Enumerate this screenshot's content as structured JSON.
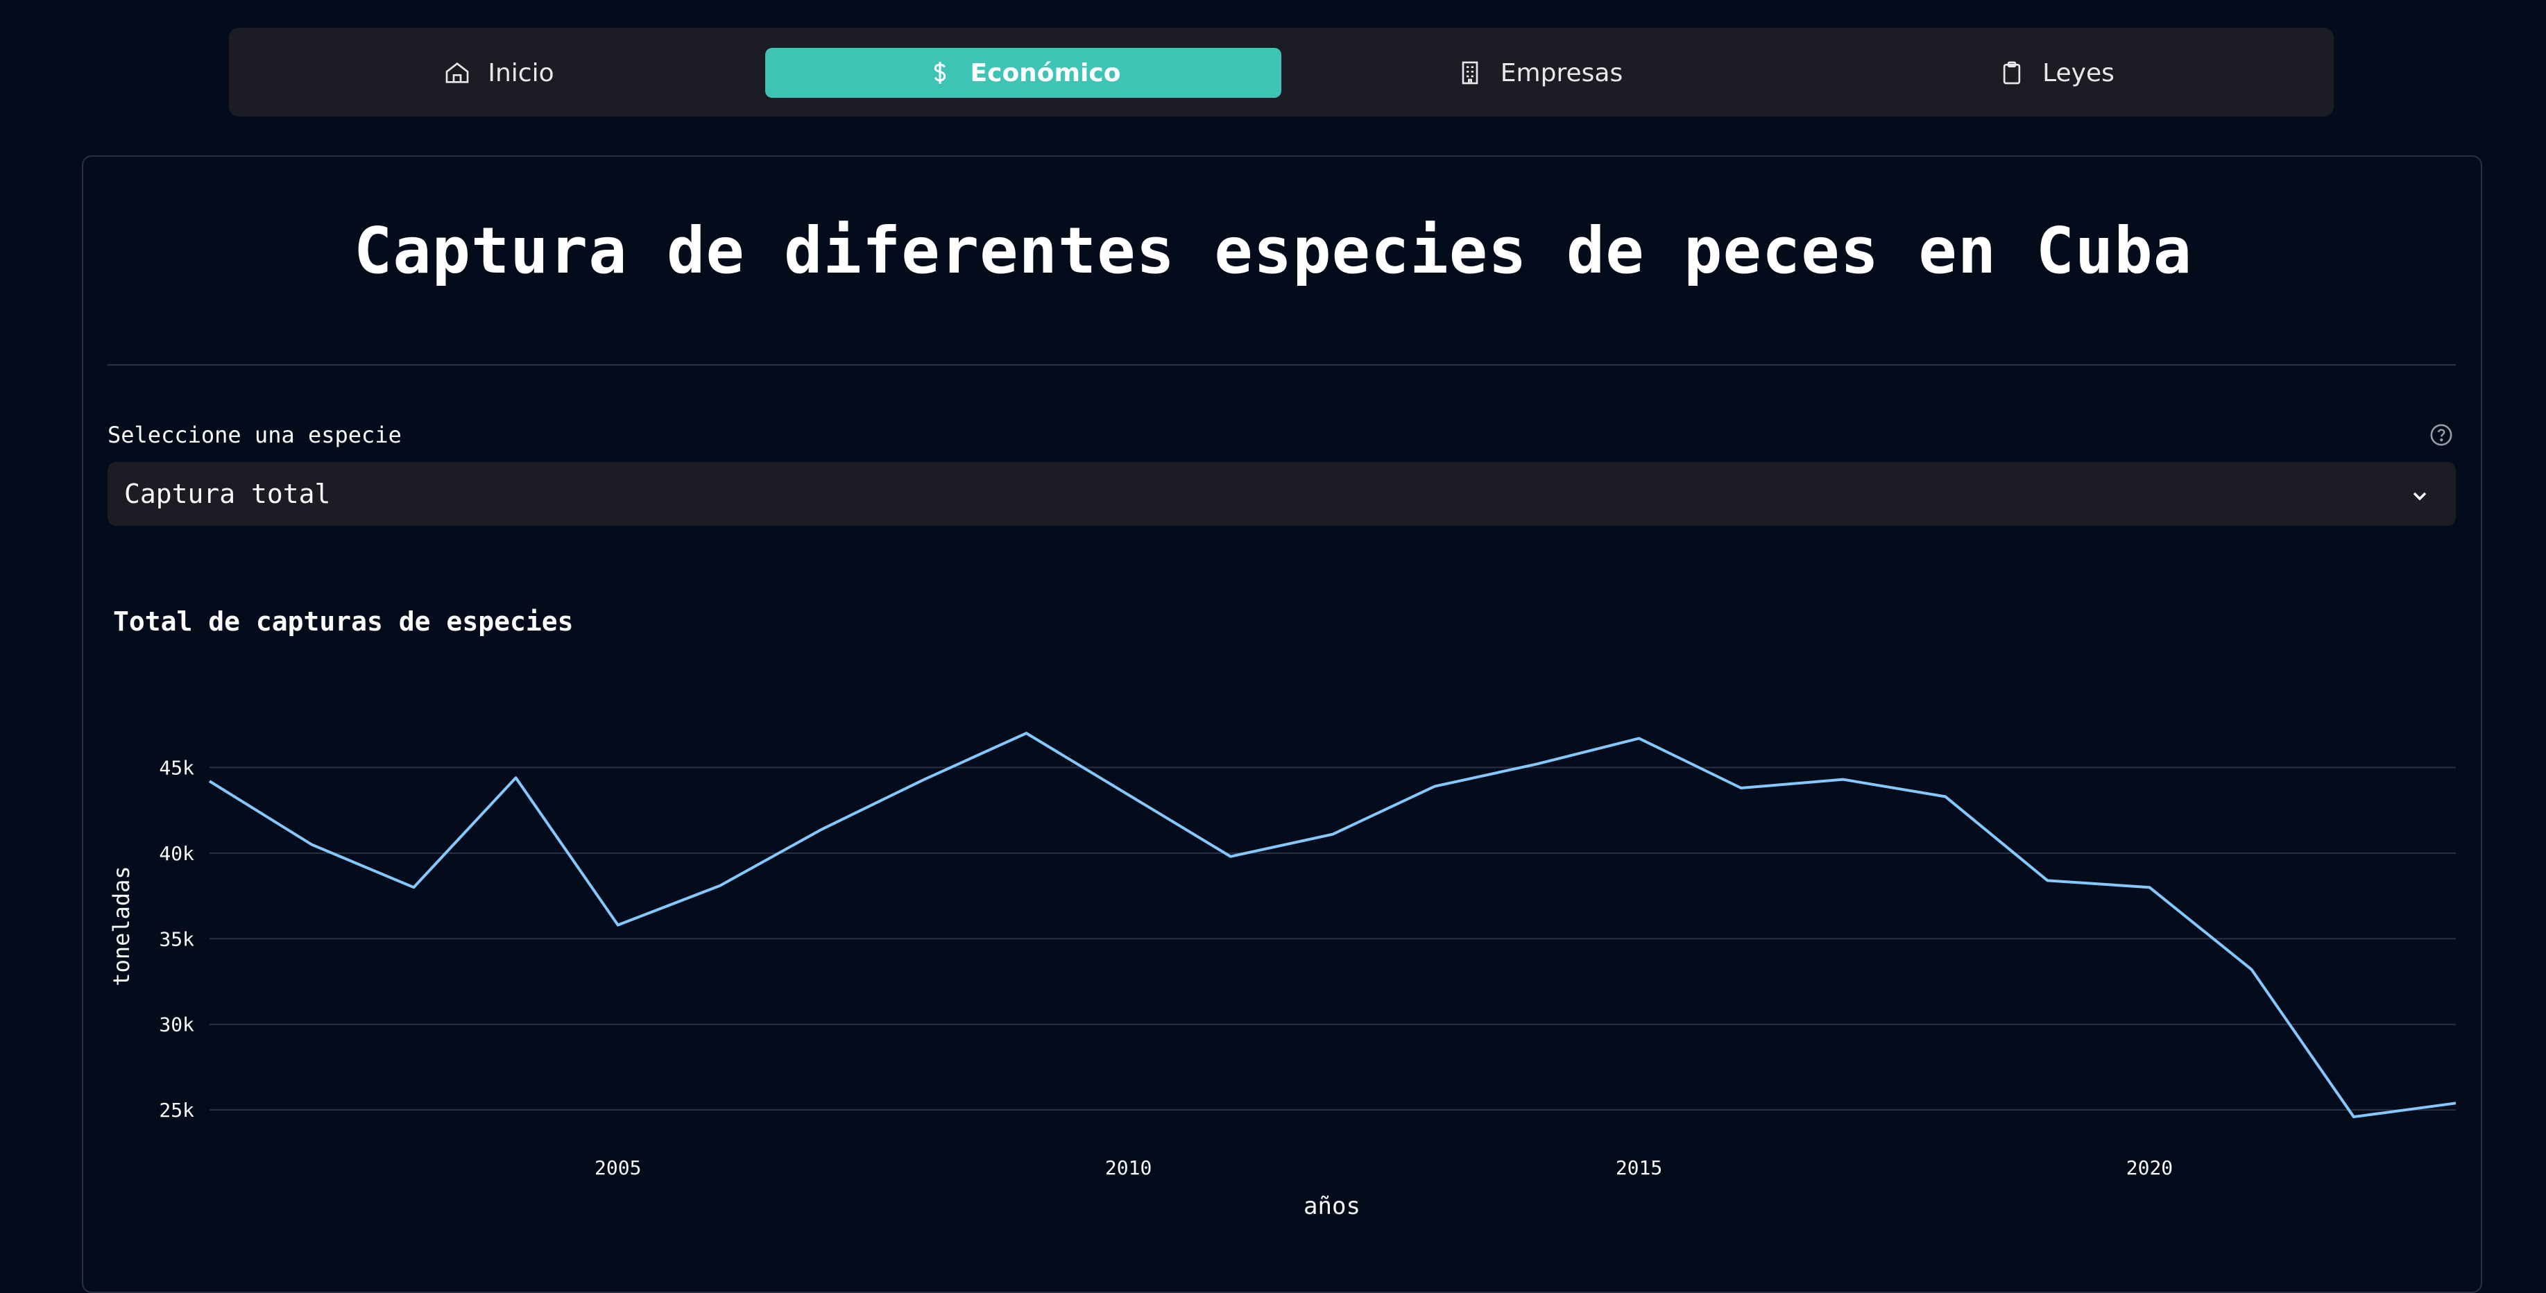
{
  "nav": {
    "tabs": [
      {
        "label": "Inicio",
        "icon": "home-icon"
      },
      {
        "label": "Económico",
        "icon": "dollar-icon",
        "active": true
      },
      {
        "label": "Empresas",
        "icon": "building-icon"
      },
      {
        "label": "Leyes",
        "icon": "clipboard-icon"
      }
    ]
  },
  "page": {
    "title": "Captura de diferentes especies de peces en Cuba"
  },
  "selector": {
    "label": "Seleccione una especie",
    "value": "Captura total"
  },
  "colors": {
    "accent": "#3ec4b5",
    "line": "#83c9ff",
    "background": "#040b1a",
    "panel": "#1c1d24"
  },
  "chart_data": {
    "type": "line",
    "title": "Total de capturas de especies",
    "xlabel": "años",
    "ylabel": "toneladas",
    "x": [
      2001,
      2002,
      2003,
      2004,
      2005,
      2006,
      2007,
      2008,
      2009,
      2010,
      2011,
      2012,
      2013,
      2014,
      2015,
      2016,
      2017,
      2018,
      2019,
      2020,
      2021,
      2022,
      2023
    ],
    "series": [
      {
        "values": [
          44200,
          40500,
          38000,
          44400,
          35800,
          38100,
          41400,
          44300,
          47000,
          43400,
          39800,
          41100,
          43900,
          45200,
          46700,
          43800,
          44300,
          43300,
          38400,
          38000,
          33200,
          24600,
          25400
        ]
      }
    ],
    "xticks": [
      "2005",
      "2010",
      "2015",
      "2020"
    ],
    "yticks": [
      "25k",
      "30k",
      "35k",
      "40k",
      "45k"
    ],
    "xlim": [
      2001,
      2023
    ],
    "ylim": [
      24400,
      47000
    ],
    "grid": true
  }
}
